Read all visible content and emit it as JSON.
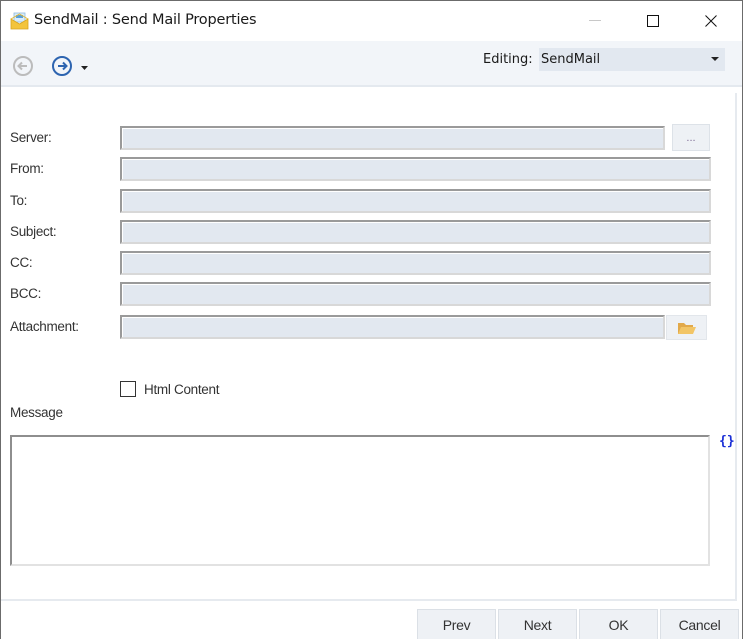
{
  "window": {
    "title": "SendMail : Send Mail Properties",
    "icons": {
      "app": "envelope-open-icon",
      "minimize": "minimize-icon",
      "maximize": "maximize-icon",
      "close": "close-icon"
    }
  },
  "toolbar": {
    "back_icon": "arrow-left-circle-icon",
    "forward_icon": "arrow-right-circle-icon",
    "dropdown_icon": "caret-down-icon",
    "editing_label": "Editing:",
    "editing_value": "SendMail"
  },
  "form": {
    "fields": [
      {
        "label": "Server:",
        "value": ""
      },
      {
        "label": "From:",
        "value": ""
      },
      {
        "label": "To:",
        "value": ""
      },
      {
        "label": "Subject:",
        "value": ""
      },
      {
        "label": "CC:",
        "value": ""
      },
      {
        "label": "BCC:",
        "value": ""
      },
      {
        "label": "Attachment:",
        "value": ""
      }
    ],
    "browse_label": "...",
    "attachment_icon": "folder-icon",
    "html_content_label": "Html Content",
    "html_content_checked": false,
    "message_label": "Message",
    "message_value": "",
    "expression_icon": "{}"
  },
  "footer": {
    "prev": "Prev",
    "next": "Next",
    "ok": "OK",
    "cancel": "Cancel"
  }
}
